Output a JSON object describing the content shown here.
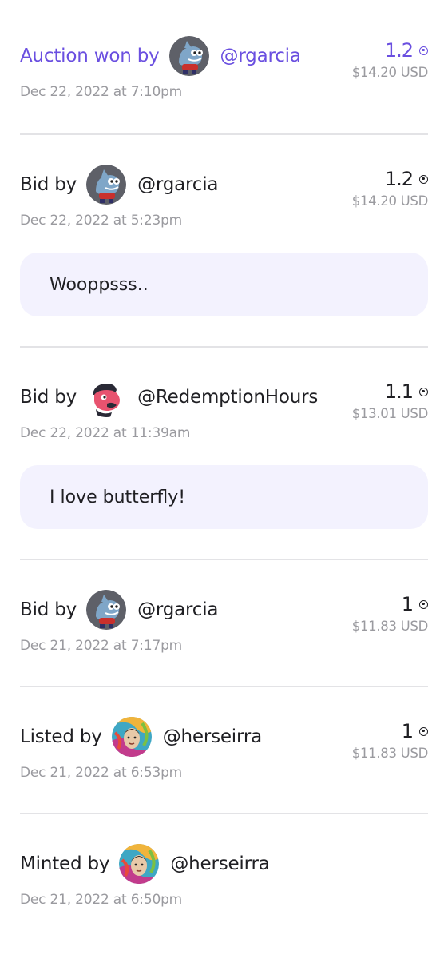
{
  "activity": [
    {
      "action": "Auction won by",
      "handle": "@rgarcia",
      "avatar": "shark-avatar-icon",
      "amount": "1.2",
      "usd": "$14.20 USD",
      "date": "Dec 22, 2022 at 7:10pm",
      "comment": null,
      "highlight": true
    },
    {
      "action": "Bid by",
      "handle": "@rgarcia",
      "avatar": "shark-avatar-icon",
      "amount": "1.2",
      "usd": "$14.20 USD",
      "date": "Dec 22, 2022 at 5:23pm",
      "comment": "Wooppsss..",
      "highlight": false
    },
    {
      "action": "Bid by",
      "handle": "@RedemptionHours",
      "avatar": "pink-character-avatar-icon",
      "amount": "1.1",
      "usd": "$13.01 USD",
      "date": "Dec 22, 2022 at 11:39am",
      "comment": "I love butterfly!",
      "highlight": false
    },
    {
      "action": "Bid by",
      "handle": "@rgarcia",
      "avatar": "shark-avatar-icon",
      "amount": "1",
      "usd": "$11.83 USD",
      "date": "Dec 21, 2022 at 7:17pm",
      "comment": null,
      "highlight": false
    },
    {
      "action": "Listed by",
      "handle": "@herseirra",
      "avatar": "colorful-portrait-avatar-icon",
      "amount": "1",
      "usd": "$11.83 USD",
      "date": "Dec 21, 2022 at 6:53pm",
      "comment": null,
      "highlight": false
    },
    {
      "action": "Minted by",
      "handle": "@herseirra",
      "avatar": "colorful-portrait-avatar-icon",
      "amount": "",
      "usd": "",
      "date": "Dec 21, 2022 at 6:50pm",
      "comment": null,
      "highlight": false
    }
  ],
  "currency_icon": "coin-icon",
  "colors": {
    "accent": "#6a4fe0",
    "comment_bg": "#f3f2fe",
    "muted": "#9a9a9f",
    "divider": "#e3e3e6"
  }
}
